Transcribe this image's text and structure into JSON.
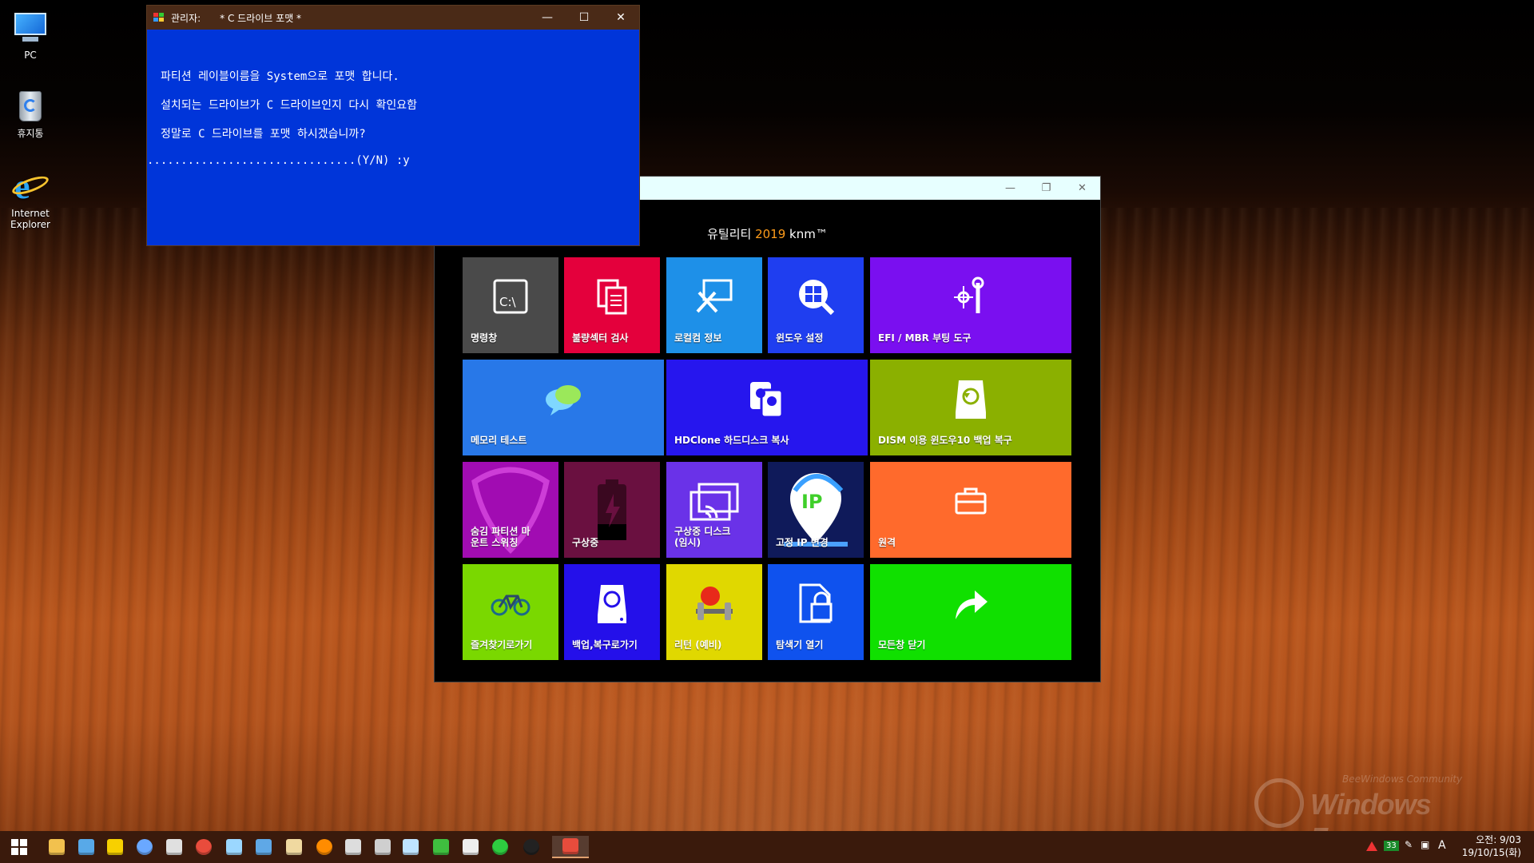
{
  "desktop": {
    "icons": [
      {
        "label": "PC",
        "icon": "computer-icon"
      },
      {
        "label": "휴지통",
        "icon": "recycle-bin-icon"
      },
      {
        "label": "Internet Explorer",
        "icon": "internet-explorer-icon"
      }
    ]
  },
  "console": {
    "title_prefix": "관리자:",
    "title": "* C 드라이브 포맷 *",
    "lines": [
      "파티션 레이블이름을 System으로 포맷 합니다.",
      "설치되는 드라이브가 C 드라이브인지 다시 확인요함",
      "정말로 C 드라이브를 포맷 하시겠습니까?",
      "...............................(Y/N) :y"
    ],
    "controls": {
      "minimize": "—",
      "maximize": "☐",
      "close": "✕"
    }
  },
  "utility": {
    "brand_prefix": "유틸리티 ",
    "brand_year": "2019",
    "brand_suffix": " knm™",
    "controls": {
      "minimize": "—",
      "restore": "❐",
      "close": "✕"
    },
    "tiles": [
      {
        "label": "명령창",
        "icon": "command-prompt-icon",
        "color": "#4a4a4a"
      },
      {
        "label": "불량섹터 검사",
        "icon": "documents-icon",
        "color": "#e4003c"
      },
      {
        "label": "로컬컴 정보",
        "icon": "remote-tools-icon",
        "color": "#1e90e8"
      },
      {
        "label": "윈도우 설정",
        "icon": "windows-search-icon",
        "color": "#1f3ef0"
      },
      {
        "label": "EFI / MBR 부팅 도구",
        "icon": "tools-icon",
        "color": "#7a0ff0"
      },
      {
        "label": "메모리 테스트",
        "icon": "chat-bubbles-icon",
        "color": "#2878e8"
      },
      {
        "label": "HDClone 하드디스크 복사",
        "icon": "disk-clone-icon",
        "color": "#2616ee"
      },
      {
        "label": "DISM 이용 윈도우10 백업 복구",
        "icon": "disk-restore-icon",
        "color": "#8bb000"
      },
      {
        "label": "숨김 파티션 마\n운트 스위칭",
        "icon": "pick-icon",
        "color": "#a10cb2"
      },
      {
        "label": "구상중",
        "icon": "battery-icon",
        "color": "#6a1040"
      },
      {
        "label": "구상중 디스크\n(임시)",
        "icon": "cast-screen-icon",
        "color": "#6a32e8"
      },
      {
        "label": "고정 IP 변경",
        "icon": "ip-pin-icon",
        "color": "#0f1a5a"
      },
      {
        "label": "원격",
        "icon": "briefcase-icon",
        "color": "#ff6a2c"
      },
      {
        "label": "즐겨찾기로가기",
        "icon": "bicycle-icon",
        "color": "#7ad800"
      },
      {
        "label": "백업,복구로가기",
        "icon": "backup-disk-icon",
        "color": "#2410ea"
      },
      {
        "label": "리턴 (예비)",
        "icon": "apple-dumbbell-icon",
        "color": "#e0d800"
      },
      {
        "label": "탐색기 열기",
        "icon": "locked-file-icon",
        "color": "#0f52ee"
      },
      {
        "label": "모든창 닫기",
        "icon": "share-arrow-icon",
        "color": "#10e000"
      }
    ]
  },
  "taskbar": {
    "start": "windows-start-icon",
    "apps": [
      "file-explorer-icon",
      "remote-desktop-icon",
      "media-player-icon",
      "browser-icon",
      "tools-icon",
      "chrome-icon",
      "notepad-icon",
      "windows-update-icon",
      "archive-icon",
      "orange-ball-icon",
      "registry-icon",
      "network-icon",
      "monitor-icon",
      "h-app-icon",
      "scissors-icon",
      "refresh-icon",
      "black-ball-icon",
      "console-app-icon"
    ],
    "tray_badge": "33",
    "ime": "A",
    "clock_time": "오전: 9/03",
    "clock_date": "19/10/15(화)"
  },
  "watermark": {
    "sub": "BeeWindows Community",
    "main": "Windows Forum"
  }
}
